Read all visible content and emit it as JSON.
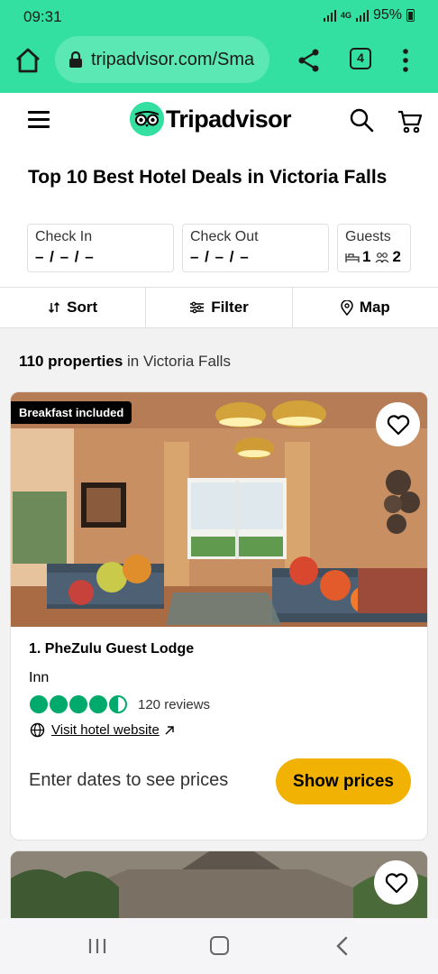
{
  "status_bar": {
    "time": "09:31",
    "network": "4G",
    "battery": "95%"
  },
  "browser": {
    "url": "tripadvisor.com/Sma",
    "tab_count": "4"
  },
  "header": {
    "brand": "Tripadvisor"
  },
  "page": {
    "title": "Top 10 Best Hotel Deals in Victoria Falls",
    "check_in": {
      "label": "Check In",
      "value": "– / – / –"
    },
    "check_out": {
      "label": "Check Out",
      "value": "– / – / –"
    },
    "guests": {
      "label": "Guests",
      "rooms": "1",
      "people": "2"
    },
    "actions": {
      "sort": "Sort",
      "filter": "Filter",
      "map": "Map"
    },
    "count": {
      "number": "110 properties",
      "suffix": " in Victoria Falls"
    }
  },
  "listings": [
    {
      "badge": "Breakfast included",
      "name": "1. PheZulu Guest Lodge",
      "type": "Inn",
      "rating": 4.5,
      "reviews": "120 reviews",
      "website_link": "Visit hotel website",
      "price_prompt": "Enter dates to see prices",
      "price_button": "Show prices"
    }
  ],
  "colors": {
    "brand_green": "#34e0a1",
    "rating_green": "#00aa6c",
    "button_yellow": "#f2b203"
  }
}
